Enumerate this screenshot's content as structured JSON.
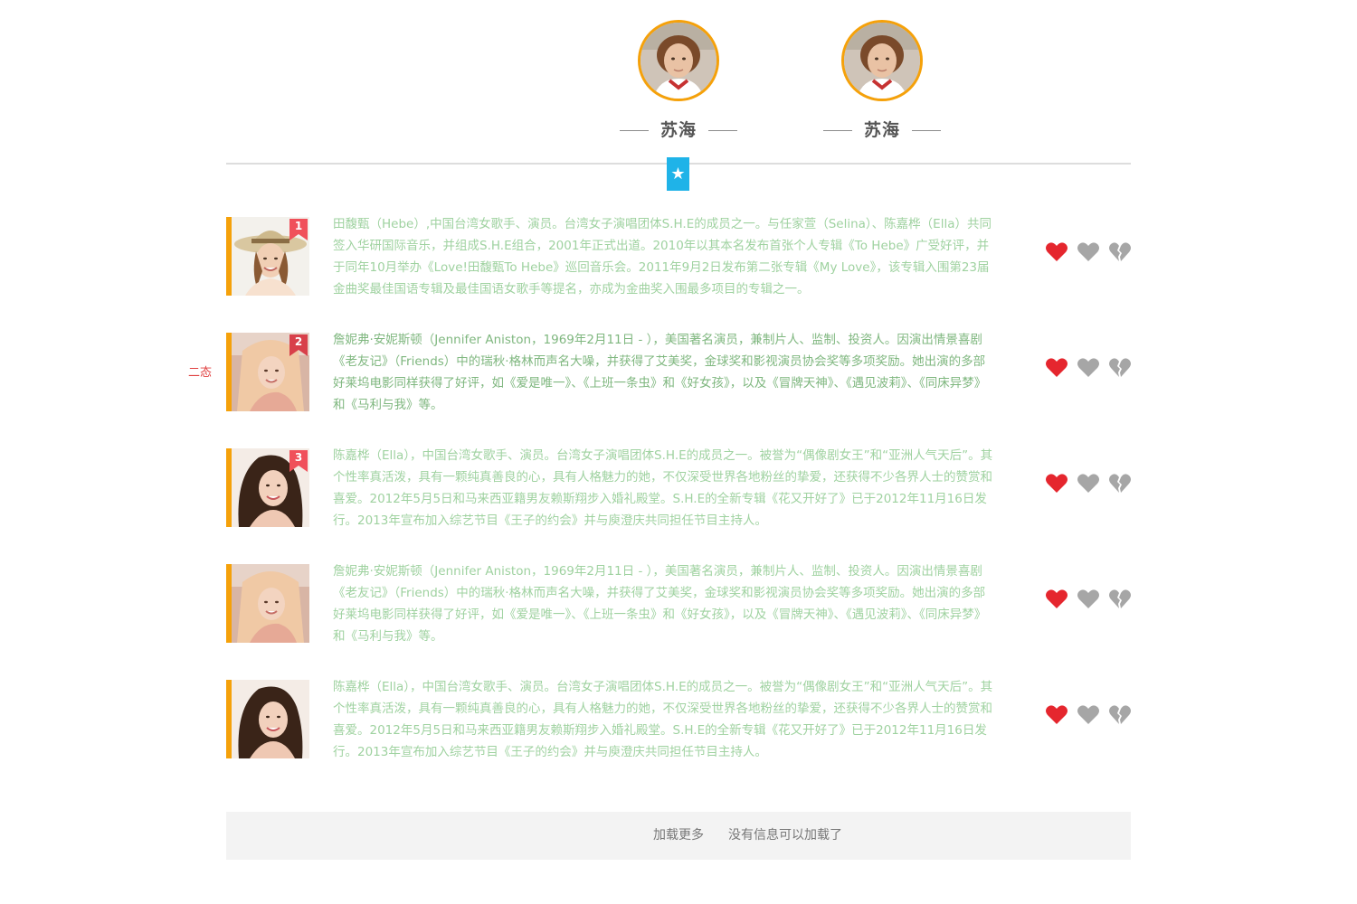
{
  "profiles": [
    {
      "name": "苏海"
    },
    {
      "name": "苏海"
    }
  ],
  "star_glyph": "★",
  "items": [
    {
      "rank": "1",
      "badge_color": "#f0505a",
      "text": "田馥甄（Hebe）,中国台湾女歌手、演员。台湾女子演唱团体S.H.E的成员之一。与任家萱（Selina）、陈嘉桦（Ella）共同签入华研国际音乐，并组成S.H.E组合，2001年正式出道。2010年以其本名发布首张个人专辑《To Hebe》广受好评，并于同年10月举办《Love!田馥甄To Hebe》巡回音乐会。2011年9月2日发布第二张专辑《My Love》，该专辑入围第23届金曲奖最佳国语专辑及最佳国语女歌手等提名，亦成为金曲奖入围最多项目的专辑之一。",
      "thumb_icon": "hat-woman-photo"
    },
    {
      "rank": "2",
      "badge_color": "#d8404a",
      "side_label": "二态",
      "text": "詹妮弗·安妮斯顿（Jennifer Aniston，1969年2月11日 - ），美国著名演员，兼制片人、监制、投资人。因演出情景喜剧《老友记》（Friends）中的瑞秋·格林而声名大噪，并获得了艾美奖，金球奖和影视演员协会奖等多项奖励。她出演的多部好莱坞电影同样获得了好评，如《爱是唯一》、《上班一条虫》和《好女孩》，以及《冒牌天神》、《遇见波莉》、《同床异梦》和《马利与我》等。",
      "thumb_icon": "blonde-woman-photo"
    },
    {
      "rank": "3",
      "badge_color": "#f0505a",
      "text": "陈嘉桦（Ella），中国台湾女歌手、演员。台湾女子演唱团体S.H.E的成员之一。被誉为“偶像剧女王”和“亚洲人气天后”。其个性率真活泼，具有一颗纯真善良的心，具有人格魅力的她，不仅深受世界各地粉丝的挚爱，还获得不少各界人士的赞赏和喜爱。2012年5月5日和马来西亚籍男友赖斯翔步入婚礼殿堂。S.H.E的全新专辑《花又开好了》已于2012年11月16日发行。2013年宣布加入综艺节目《王子的约会》并与庾澄庆共同担任节目主持人。",
      "thumb_icon": "dark-hair-woman-photo"
    },
    {
      "rank": "",
      "text": "詹妮弗·安妮斯顿（Jennifer Aniston，1969年2月11日 - ），美国著名演员，兼制片人、监制、投资人。因演出情景喜剧《老友记》（Friends）中的瑞秋·格林而声名大噪，并获得了艾美奖，金球奖和影视演员协会奖等多项奖励。她出演的多部好莱坞电影同样获得了好评，如《爱是唯一》、《上班一条虫》和《好女孩》，以及《冒牌天神》、《遇见波莉》、《同床异梦》和《马利与我》等。",
      "thumb_icon": "blonde-woman-photo"
    },
    {
      "rank": "",
      "text": "陈嘉桦（Ella），中国台湾女歌手、演员。台湾女子演唱团体S.H.E的成员之一。被誉为“偶像剧女王”和“亚洲人气天后”。其个性率真活泼，具有一颗纯真善良的心，具有人格魅力的她，不仅深受世界各地粉丝的挚爱，还获得不少各界人士的赞赏和喜爱。2012年5月5日和马来西亚籍男友赖斯翔步入婚礼殿堂。S.H.E的全新专辑《花又开好了》已于2012年11月16日发行。2013年宣布加入综艺节目《王子的约会》并与庾澄庆共同担任节目主持人。",
      "thumb_icon": "dark-hair-woman-photo"
    }
  ],
  "hearts": {
    "liked_icon": "red-heart-icon",
    "like_icon": "gray-heart-icon",
    "dislike_icon": "broken-heart-icon",
    "liked_color": "#e5262e",
    "inactive_color": "#a6a6a6"
  },
  "footer": {
    "load_more": "加载更多",
    "no_more": "没有信息可以加载了"
  },
  "colors": {
    "accent_orange": "#f5a10a",
    "accent_blue": "#1fb3e8",
    "text_green": "#9fd2a0"
  }
}
